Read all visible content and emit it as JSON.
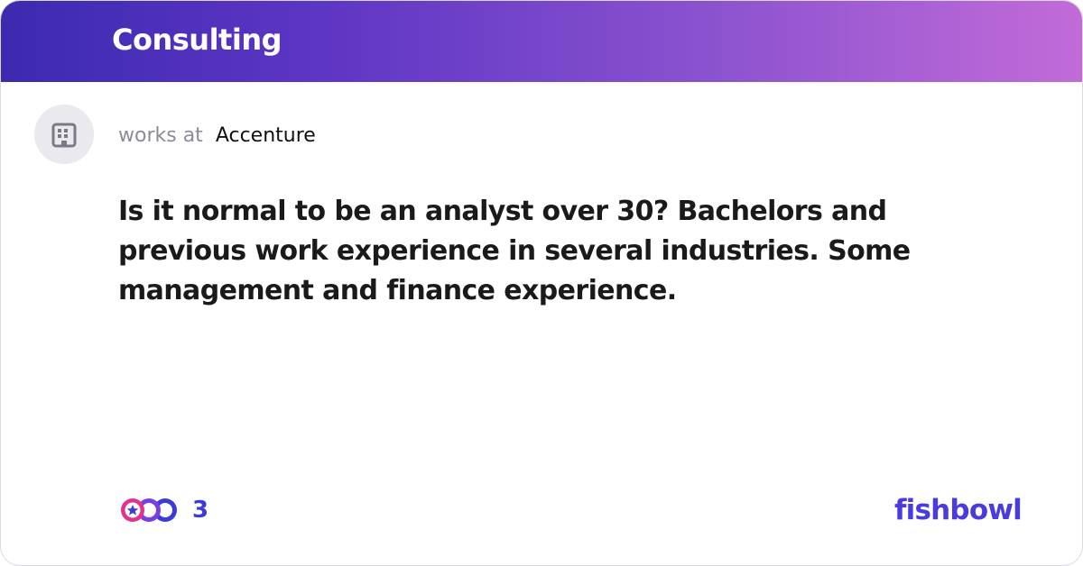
{
  "header": {
    "title": "Consulting"
  },
  "author": {
    "avatar_icon": "building-icon",
    "works_at_label": "works at",
    "company": "Accenture"
  },
  "post": {
    "text": "Is it normal to be an analyst over 30? Bachelors and previous work experience in several industries. Some management and finance experience."
  },
  "reactions": {
    "icon": "reaction-stack-icon",
    "count": "3"
  },
  "brand": {
    "logo_text": "fishbowl"
  },
  "colors": {
    "header_gradient_start": "#3c2ab0",
    "header_gradient_end": "#c26bd8",
    "brand": "#4a3be0",
    "count": "#3b3bd6"
  }
}
